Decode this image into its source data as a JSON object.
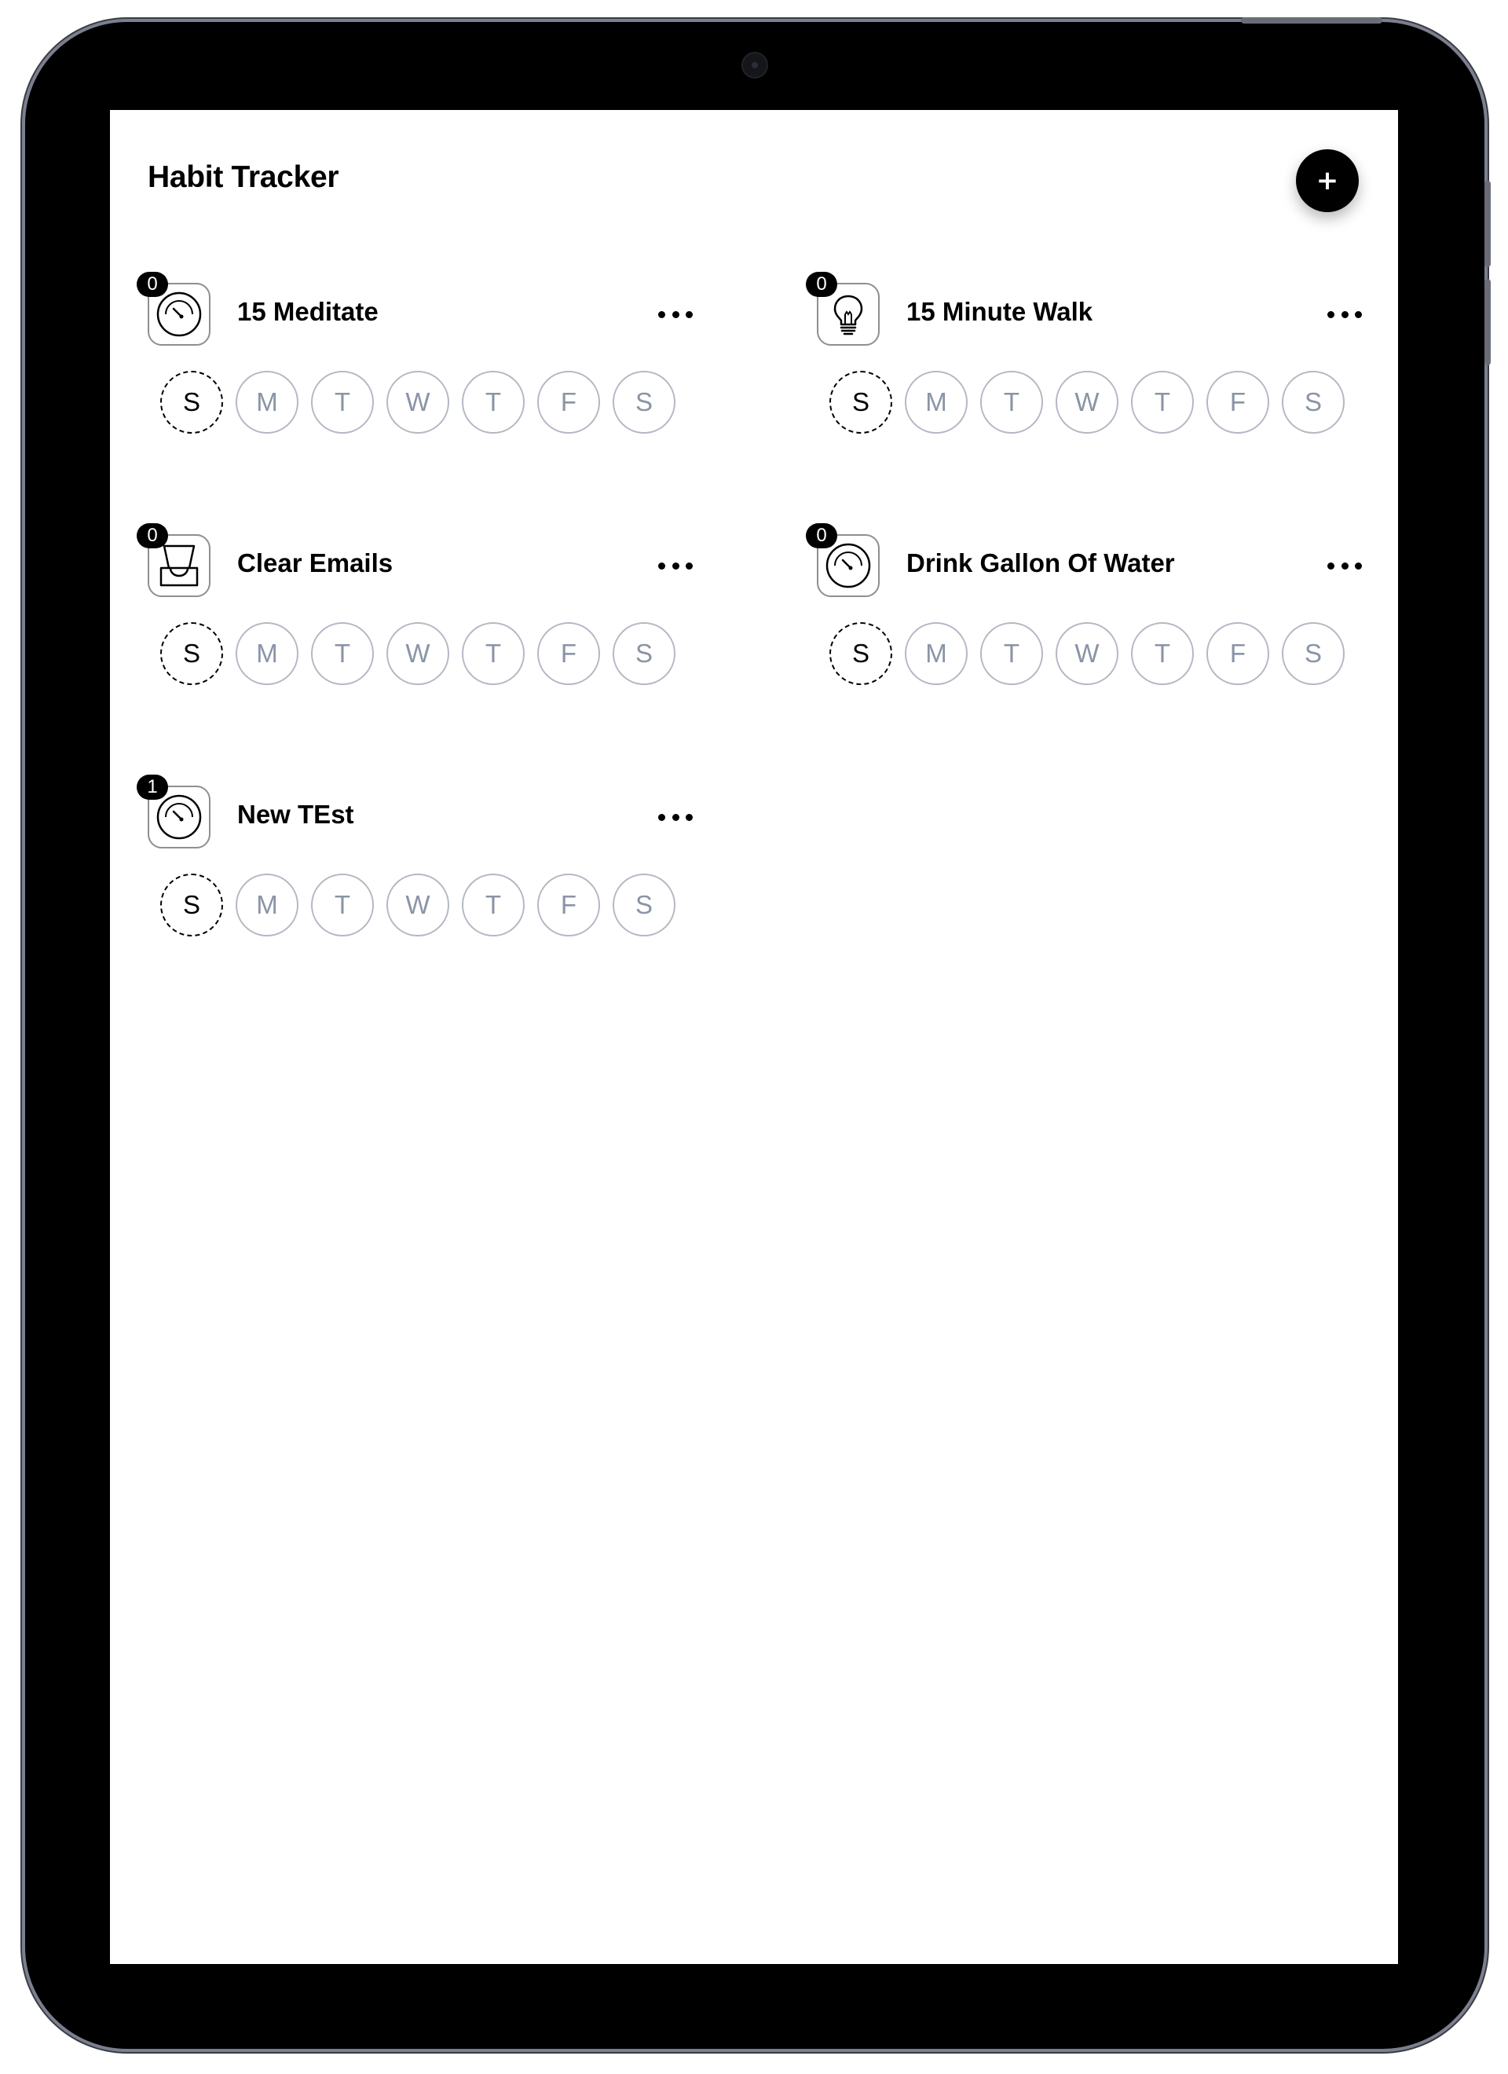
{
  "app": {
    "title": "Habit Tracker",
    "add_label": "+"
  },
  "habits": [
    {
      "name": "15 Meditate",
      "count": "0",
      "icon": "gauge-icon",
      "days": [
        "S",
        "M",
        "T",
        "W",
        "T",
        "F",
        "S"
      ],
      "today_index": 0
    },
    {
      "name": "15 Minute Walk",
      "count": "0",
      "icon": "lightbulb-icon",
      "days": [
        "S",
        "M",
        "T",
        "W",
        "T",
        "F",
        "S"
      ],
      "today_index": 0
    },
    {
      "name": "Clear Emails",
      "count": "0",
      "icon": "inbox-tray-icon",
      "days": [
        "S",
        "M",
        "T",
        "W",
        "T",
        "F",
        "S"
      ],
      "today_index": 0
    },
    {
      "name": "Drink Gallon Of Water",
      "count": "0",
      "icon": "gauge-icon",
      "days": [
        "S",
        "M",
        "T",
        "W",
        "T",
        "F",
        "S"
      ],
      "today_index": 0
    },
    {
      "name": "New TEst",
      "count": "1",
      "icon": "gauge-icon",
      "days": [
        "S",
        "M",
        "T",
        "W",
        "T",
        "F",
        "S"
      ],
      "today_index": 0
    }
  ],
  "colors": {
    "accent": "#000000",
    "day_border": "#b3b8c4",
    "day_text": "#8a94a6",
    "device_frame": "#000000"
  }
}
